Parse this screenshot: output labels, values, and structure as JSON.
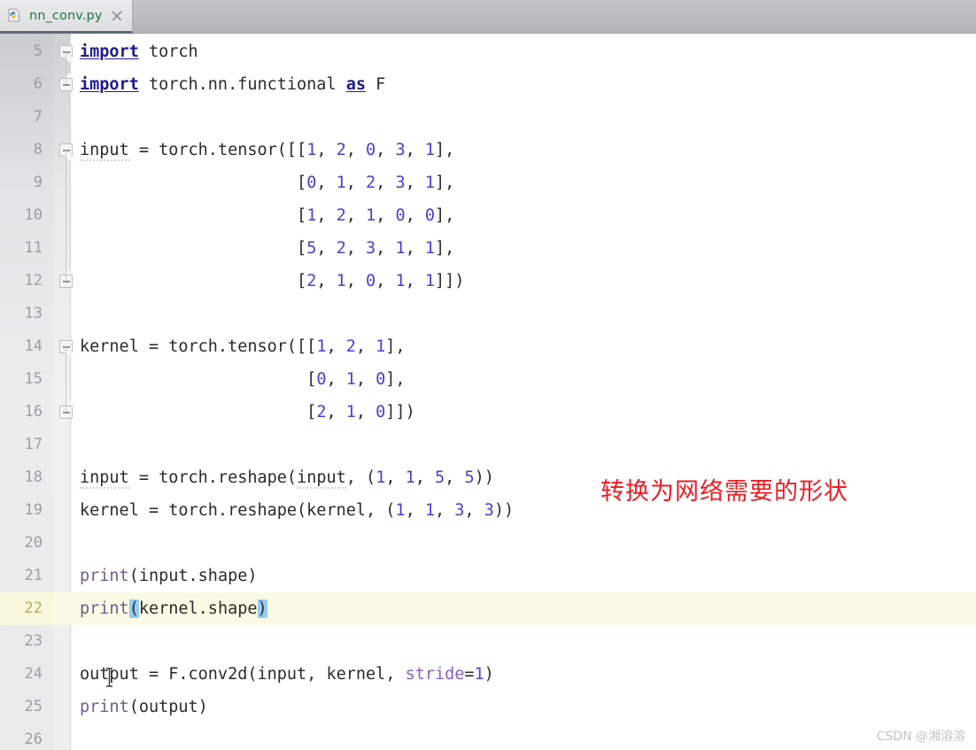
{
  "window": {
    "app": "PyCharm Editor",
    "accent_red": "#ee1b22",
    "keyword_color": "#1d1d8f",
    "number_color": "#4a3fd6",
    "function_color": "#6b5f8f",
    "param_color": "#8a5fbf",
    "current_line_color": "#fcfae4",
    "bracket_match_color": "#95cbf0"
  },
  "tabbar": {
    "tabs": [
      {
        "label": "nn_conv.py",
        "icon": "python-file-icon",
        "close_icon": "close-icon",
        "active": true
      }
    ]
  },
  "editor": {
    "first_line": 5,
    "current_line": 22,
    "lines": [
      {
        "n": 5,
        "text": "import torch",
        "fold": "start"
      },
      {
        "n": 6,
        "text": "import torch.nn.functional as F",
        "fold": "end"
      },
      {
        "n": 7,
        "text": ""
      },
      {
        "n": 8,
        "text": "input = torch.tensor([[1, 2, 0, 3, 1],",
        "fold": "start"
      },
      {
        "n": 9,
        "text": "                      [0, 1, 2, 3, 1],"
      },
      {
        "n": 10,
        "text": "                      [1, 2, 1, 0, 0],"
      },
      {
        "n": 11,
        "text": "                      [5, 2, 3, 1, 1],"
      },
      {
        "n": 12,
        "text": "                      [2, 1, 0, 1, 1]])",
        "fold": "end"
      },
      {
        "n": 13,
        "text": ""
      },
      {
        "n": 14,
        "text": "kernel = torch.tensor([[1, 2, 1],",
        "fold": "start"
      },
      {
        "n": 15,
        "text": "                       [0, 1, 0],"
      },
      {
        "n": 16,
        "text": "                       [2, 1, 0]])",
        "fold": "end"
      },
      {
        "n": 17,
        "text": ""
      },
      {
        "n": 18,
        "text": "input = torch.reshape(input, (1, 1, 5, 5))"
      },
      {
        "n": 19,
        "text": "kernel = torch.reshape(kernel, (1, 1, 3, 3))"
      },
      {
        "n": 20,
        "text": ""
      },
      {
        "n": 21,
        "text": "print(input.shape)"
      },
      {
        "n": 22,
        "text": "print(kernel.shape)"
      },
      {
        "n": 23,
        "text": ""
      },
      {
        "n": 24,
        "text": "output = F.conv2d(input, kernel, stride=1)"
      },
      {
        "n": 25,
        "text": "print(output)"
      },
      {
        "n": 26,
        "text": ""
      }
    ]
  },
  "annotation": {
    "text": "转换为网络需要的形状"
  },
  "watermark": {
    "text": "CSDN @湘溶溶"
  }
}
